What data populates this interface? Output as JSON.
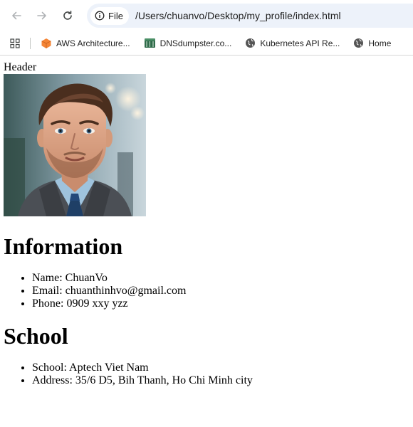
{
  "browser": {
    "site_chip_label": "File",
    "url": "/Users/chuanvo/Desktop/my_profile/index.html",
    "bookmarks": [
      {
        "label": "AWS Architecture...",
        "icon": "aws-cube-icon",
        "color": "#f58536"
      },
      {
        "label": "DNSdumpster.co...",
        "icon": "dnsdumpster-icon",
        "color": "#2f6b4a"
      },
      {
        "label": "Kubernetes API Re...",
        "icon": "globe-icon",
        "color": "#555555"
      },
      {
        "label": "Home",
        "icon": "globe-icon",
        "color": "#555555"
      }
    ]
  },
  "page": {
    "header_text": "Header",
    "photo_alt": "profile-photo",
    "information": {
      "heading": "Information",
      "items": [
        "Name: ChuanVo",
        "Email: chuanthinhvo@gmail.com",
        "Phone: 0909 xxy yzz"
      ]
    },
    "school": {
      "heading": "School",
      "items": [
        "School: Aptech Viet Nam",
        "Address: 35/6 D5, Bih Thanh, Ho Chi Minh city"
      ]
    }
  }
}
